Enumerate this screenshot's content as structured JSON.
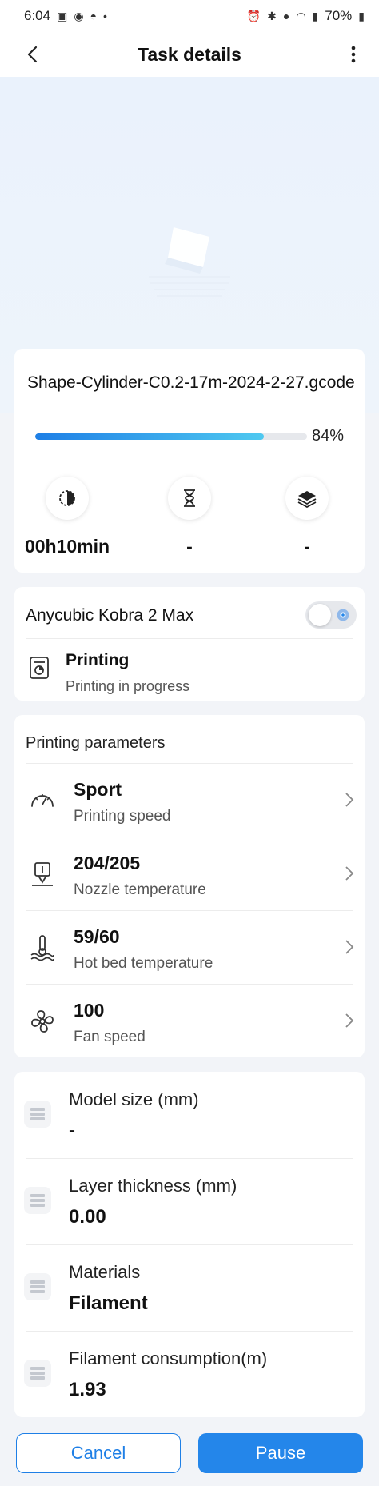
{
  "status_bar": {
    "time": "6:04",
    "battery": "70%"
  },
  "header": {
    "title": "Task details"
  },
  "job": {
    "file_name": "Shape-Cylinder-C0.2-17m-2024-2-27.gcode",
    "progress_percent": 84,
    "progress_label": "84%",
    "stats": [
      {
        "icon": "print-time-icon",
        "value": "00h10min"
      },
      {
        "icon": "hourglass-icon",
        "value": "-"
      },
      {
        "icon": "layers-icon",
        "value": "-"
      }
    ]
  },
  "printer": {
    "name": "Anycubic Kobra 2 Max",
    "toggle_on": false,
    "status_title": "Printing",
    "status_subtitle": "Printing in progress"
  },
  "parameters": {
    "heading": "Printing parameters",
    "items": [
      {
        "icon": "speedometer-icon",
        "value": "Sport",
        "label": "Printing speed"
      },
      {
        "icon": "nozzle-thermometer-icon",
        "value": "204/205",
        "label": "Nozzle temperature"
      },
      {
        "icon": "hot-bed-icon",
        "value": "59/60",
        "label": "Hot bed temperature"
      },
      {
        "icon": "fan-icon",
        "value": "100",
        "label": "Fan speed"
      }
    ]
  },
  "model_info": {
    "items": [
      {
        "label": "Model size (mm)",
        "value": "-"
      },
      {
        "label": "Layer thickness (mm)",
        "value": "0.00"
      },
      {
        "label": "Materials",
        "value": "Filament"
      },
      {
        "label": "Filament consumption(m)",
        "value": "1.93"
      }
    ]
  },
  "actions": {
    "cancel_label": "Cancel",
    "pause_label": "Pause"
  },
  "colors": {
    "accent": "#2486ea",
    "progress_start": "#1e7fe6",
    "progress_end": "#4fc9f0"
  }
}
